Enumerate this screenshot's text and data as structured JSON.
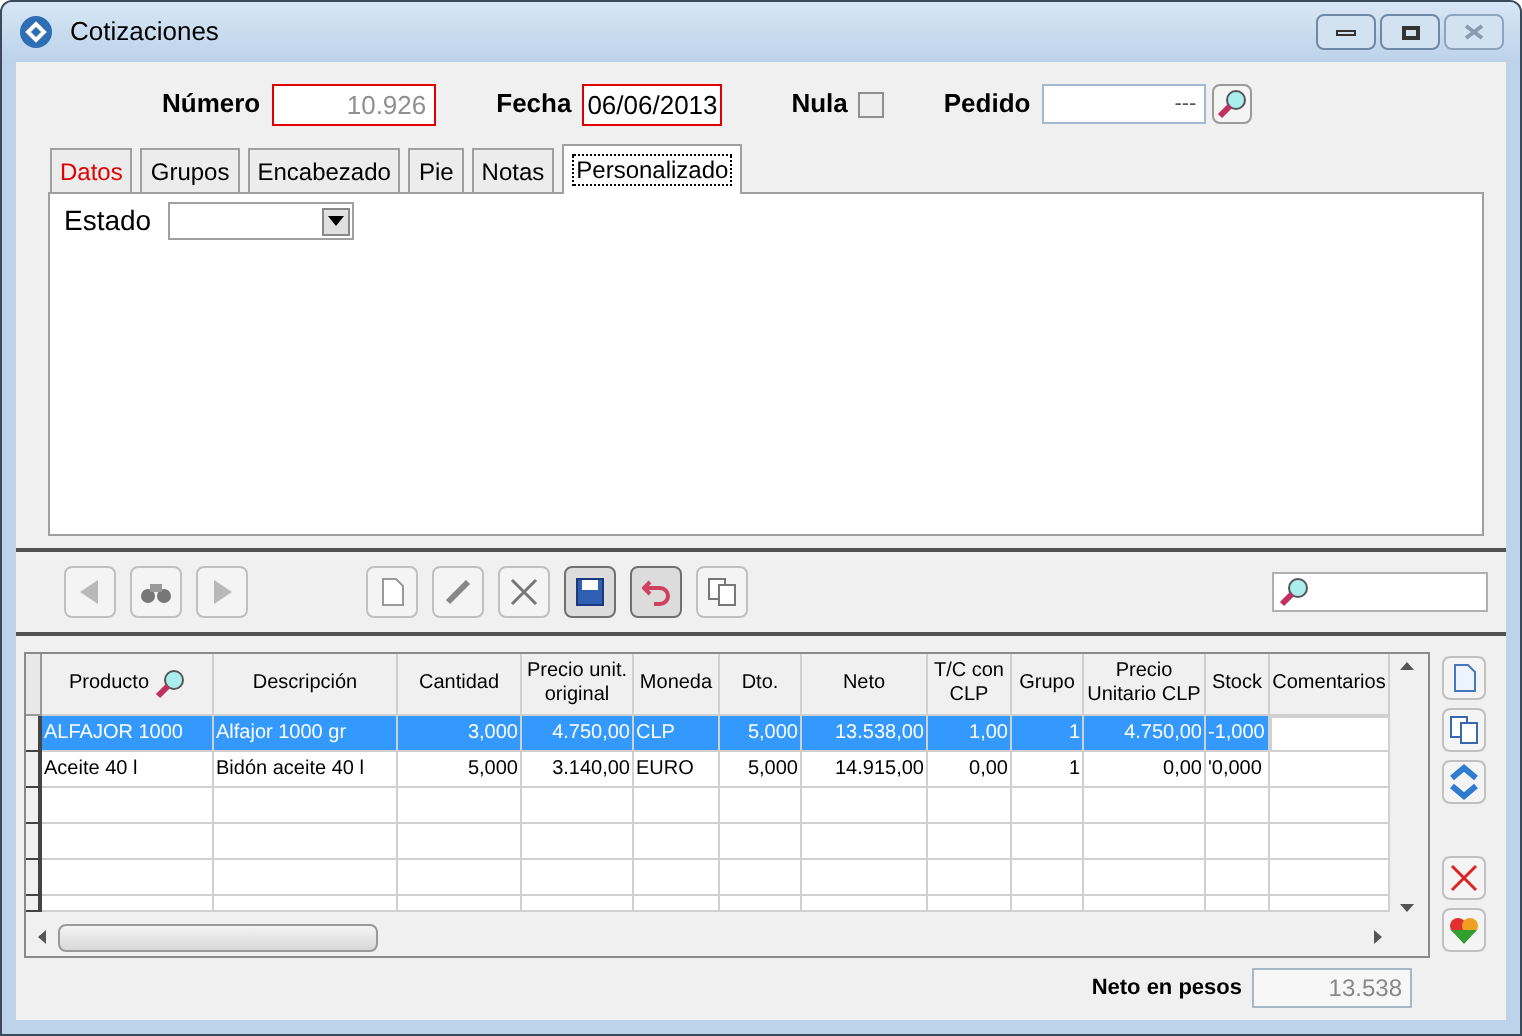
{
  "window": {
    "title": "Cotizaciones"
  },
  "header": {
    "numero": {
      "label": "Número",
      "value": "10.926"
    },
    "fecha": {
      "label": "Fecha",
      "value": "06/06/2013"
    },
    "nula": {
      "label": "Nula",
      "checked": false
    },
    "pedido": {
      "label": "Pedido",
      "value": "---"
    }
  },
  "tabs": [
    {
      "label": "Datos",
      "selected": false,
      "alert": true
    },
    {
      "label": "Grupos",
      "selected": false,
      "alert": false
    },
    {
      "label": "Encabezado",
      "selected": false,
      "alert": false
    },
    {
      "label": "Pie",
      "selected": false,
      "alert": false
    },
    {
      "label": "Notas",
      "selected": false,
      "alert": false
    },
    {
      "label": "Personalizado",
      "selected": true,
      "alert": false
    }
  ],
  "estado": {
    "label": "Estado"
  },
  "table": {
    "columns": [
      "Producto",
      "Descripción",
      "Cantidad",
      "Precio unit. original",
      "Moneda",
      "Dto.",
      "Neto",
      "T/C con CLP",
      "Grupo",
      "Precio Unitario CLP",
      "Stock",
      "Comentarios"
    ],
    "rows": [
      {
        "selected": true,
        "cells": [
          "ALFAJOR 1000",
          "Alfajor 1000 gr",
          "3,000",
          "4.750,00",
          "CLP",
          "5,000",
          "13.538,00",
          "1,00",
          "1",
          "4.750,00",
          "-1,000",
          ""
        ]
      },
      {
        "selected": false,
        "cells": [
          "Aceite 40 l",
          "Bidón aceite 40 l",
          "5,000",
          "3.140,00",
          "EURO",
          "5,000",
          "14.915,00",
          "0,00",
          "1",
          "0,00",
          "'0,000",
          ""
        ]
      }
    ]
  },
  "footer": {
    "label": "Neto en pesos",
    "value": "13.538"
  }
}
